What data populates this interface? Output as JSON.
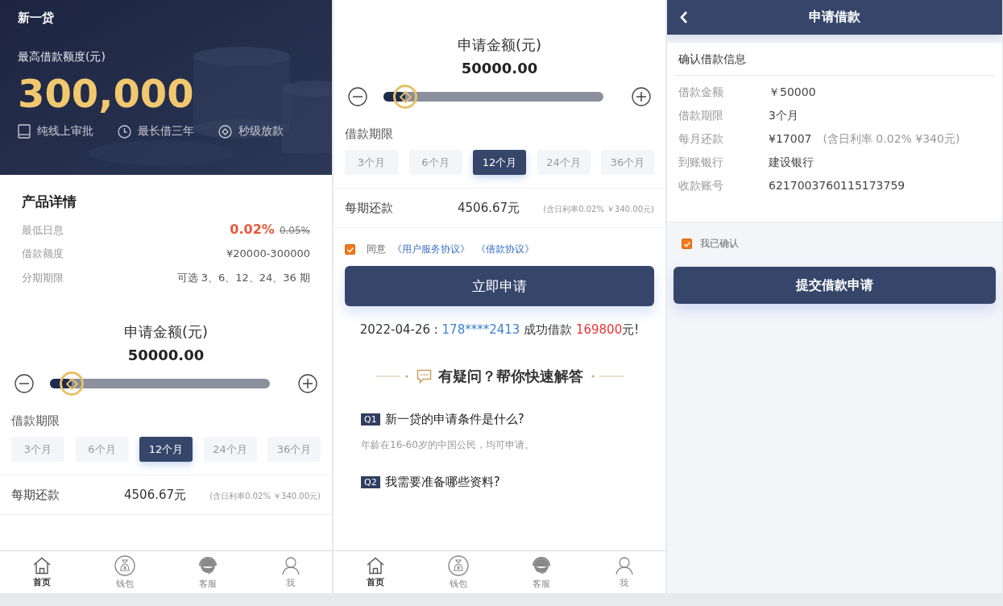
{
  "panels": [
    {
      "sections": [
        {
          "kind": "hero",
          "brand": "新一贷",
          "label": "最高借款额度(元)",
          "amount": "300,000",
          "features": [
            {
              "text": "纯线上审批"
            },
            {
              "text": "最长借三年"
            },
            {
              "text": "秒级放款"
            }
          ]
        },
        {
          "kind": "details",
          "title": "产品详情",
          "rows": [
            {
              "label": "最低日息",
              "value": "0.02%",
              "old": "0.05%"
            },
            {
              "label": "借款额度",
              "value": "¥20000-300000"
            },
            {
              "label": "分期期限",
              "value": "可选 3、6、12、24、36 期"
            }
          ]
        },
        {
          "kind": "amount",
          "label": "申请金额(元)",
          "value": "50000.00",
          "level": 0.1
        },
        {
          "kind": "periods",
          "label": "借款期限",
          "options": [
            {
              "text": "3个月",
              "selected": false
            },
            {
              "text": "6个月",
              "selected": false
            },
            {
              "text": "12个月",
              "selected": true
            },
            {
              "text": "24个月",
              "selected": false
            },
            {
              "text": "36个月",
              "selected": false
            }
          ]
        },
        {
          "kind": "repayment",
          "label": "每期还款",
          "value": "4506.67元",
          "note": "(含日利率0.02% ￥340.00元)"
        }
      ],
      "tabbar": [
        {
          "text": "首页",
          "selected": true
        },
        {
          "text": "钱包",
          "selected": false
        },
        {
          "text": "客服",
          "selected": false
        },
        {
          "text": "我",
          "selected": false
        }
      ]
    },
    {
      "sections": [
        {
          "kind": "amount",
          "label": "申请金额(元)",
          "value": "50000.00",
          "level": 0.1
        },
        {
          "kind": "periods",
          "label": "借款期限",
          "options": [
            {
              "text": "3个月",
              "selected": false
            },
            {
              "text": "6个月",
              "selected": false
            },
            {
              "text": "12个月",
              "selected": true
            },
            {
              "text": "24个月",
              "selected": false
            },
            {
              "text": "36个月",
              "selected": false
            }
          ]
        },
        {
          "kind": "repayment",
          "label": "每期还款",
          "value": "4506.67元",
          "note": "(含日利率0.02% ￥340.00元)"
        },
        {
          "kind": "agreement",
          "checked": true,
          "text": "同意",
          "links": [
            "《用户服务协议》",
            "《借款协议》"
          ]
        },
        {
          "kind": "button",
          "text": "立即申请"
        },
        {
          "kind": "ticker",
          "date": "2022-04-26 : ",
          "phone": "178****2413",
          "verb": " 成功借款 ",
          "amount": "169800",
          "suffix": "元!"
        },
        {
          "kind": "faq_title",
          "text": "有疑问？帮你快速解答"
        },
        {
          "kind": "faq",
          "badge": "Q1",
          "question": "新一贷的申请条件是什么?",
          "answer": "年龄在16-60岁的中国公民，均可申请。"
        },
        {
          "kind": "faq",
          "badge": "Q2",
          "question": "我需要准备哪些资料?"
        }
      ],
      "tabbar": [
        {
          "text": "首页",
          "selected": true
        },
        {
          "text": "钱包",
          "selected": false
        },
        {
          "text": "客服",
          "selected": false
        },
        {
          "text": "我",
          "selected": false
        }
      ]
    },
    {
      "sections": [
        {
          "kind": "navbar",
          "title": "申请借款"
        },
        {
          "kind": "confirm",
          "title": "确认借款信息",
          "rows": [
            {
              "label": "借款金额",
              "value": "￥50000"
            },
            {
              "label": "借款期限",
              "value": "3个月"
            },
            {
              "label": "每月还款",
              "value": "¥17007",
              "note": "(含日利率 0.02% ¥340元)"
            },
            {
              "label": "到账银行",
              "value": "建设银行"
            },
            {
              "label": "收款账号",
              "value": "6217003760115173759"
            }
          ]
        },
        {
          "kind": "check",
          "checked": true,
          "text": "我已确认"
        },
        {
          "kind": "submit",
          "text": "提交借款申请"
        }
      ]
    }
  ]
}
